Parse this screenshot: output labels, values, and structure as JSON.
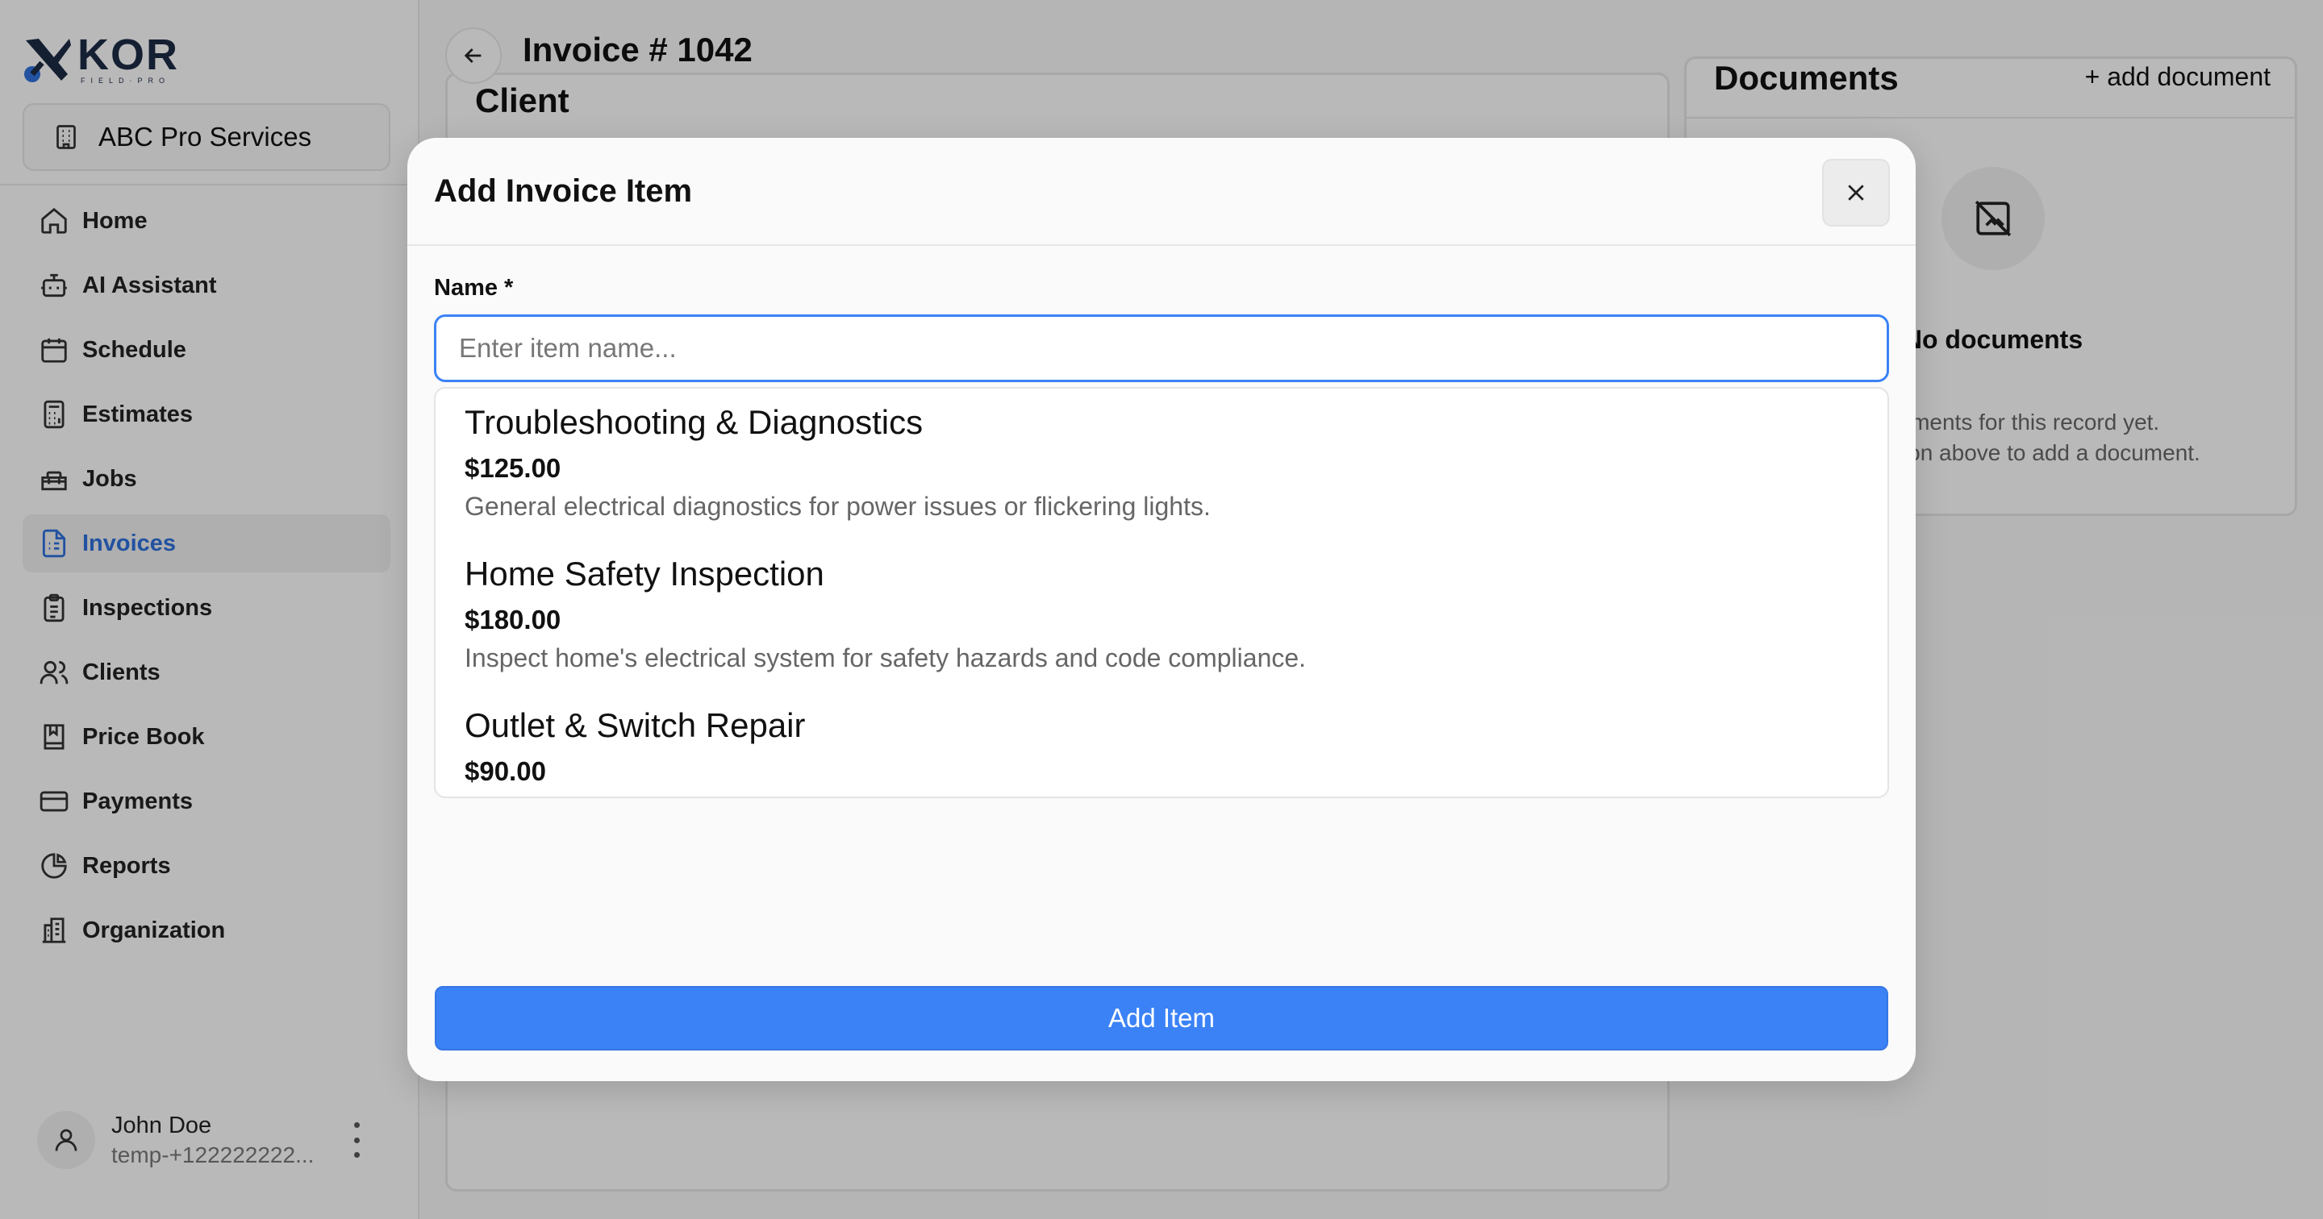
{
  "brand": {
    "logo_main": "KOR",
    "logo_sub": "FIELD·PRO"
  },
  "org": {
    "name": "ABC Pro Services"
  },
  "sidebar": {
    "items": [
      {
        "label": "Home",
        "icon": "home-icon",
        "active": false
      },
      {
        "label": "AI Assistant",
        "icon": "bot-icon",
        "active": false
      },
      {
        "label": "Schedule",
        "icon": "calendar-icon",
        "active": false
      },
      {
        "label": "Estimates",
        "icon": "calculator-icon",
        "active": false
      },
      {
        "label": "Jobs",
        "icon": "toolbox-icon",
        "active": false
      },
      {
        "label": "Invoices",
        "icon": "invoice-icon",
        "active": true
      },
      {
        "label": "Inspections",
        "icon": "clipboard-list-icon",
        "active": false
      },
      {
        "label": "Clients",
        "icon": "users-icon",
        "active": false
      },
      {
        "label": "Price Book",
        "icon": "book-icon",
        "active": false
      },
      {
        "label": "Payments",
        "icon": "credit-card-icon",
        "active": false
      },
      {
        "label": "Reports",
        "icon": "pie-chart-icon",
        "active": false
      },
      {
        "label": "Organization",
        "icon": "building-icon",
        "active": false
      }
    ]
  },
  "user": {
    "name": "John Doe",
    "phone": "temp-+122222222..."
  },
  "header": {
    "title": "Invoice # 1042"
  },
  "client_card": {
    "title": "Client"
  },
  "documents": {
    "title": "Documents",
    "add_label": "+ add document",
    "empty_title": "No documents",
    "empty_desc_line1": "No documents for this record yet.",
    "empty_desc_line2": "Use the button above to add a document."
  },
  "modal": {
    "title": "Add Invoice Item",
    "name_label": "Name *",
    "name_placeholder": "Enter item name...",
    "name_value": "",
    "suggestions": [
      {
        "name": "Troubleshooting & Diagnostics",
        "price": "$125.00",
        "description": "General electrical diagnostics for power issues or flickering lights."
      },
      {
        "name": "Home Safety Inspection",
        "price": "$180.00",
        "description": "Inspect home's electrical system for safety hazards and code compliance."
      },
      {
        "name": "Outlet & Switch Repair",
        "price": "$90.00",
        "description": ""
      }
    ],
    "submit_label": "Add Item"
  },
  "colors": {
    "accent": "#3b82f6",
    "active_nav": "#2f6fd8",
    "brand_navy": "#1b2a44"
  }
}
